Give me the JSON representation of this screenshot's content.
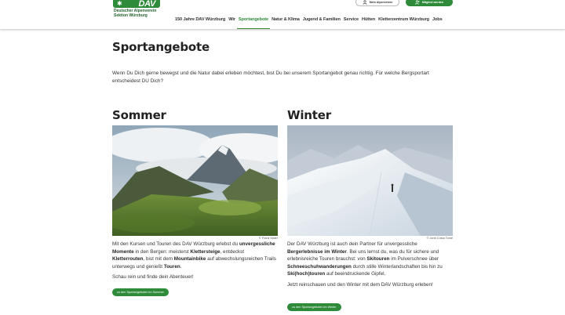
{
  "header": {
    "logo_text": "DAV",
    "org_line1": "Deutscher Alpenverein",
    "org_line2": "Sektion Würzburg",
    "account_button": "Mein Alpenverein",
    "member_button": "Mitglied werden",
    "nav": [
      {
        "label": "150 Jahre DAV Würzburg",
        "active": false
      },
      {
        "label": "Wir",
        "active": false
      },
      {
        "label": "Sportangebote",
        "active": true
      },
      {
        "label": "Natur & Klima",
        "active": false
      },
      {
        "label": "Jugend & Familien",
        "active": false
      },
      {
        "label": "Service",
        "active": false
      },
      {
        "label": "Hütten",
        "active": false
      },
      {
        "label": "Kletterzentrum Würzburg",
        "active": false
      },
      {
        "label": "Jobs",
        "active": false
      }
    ]
  },
  "main": {
    "title": "Sportangebote",
    "intro": "Wenn Du Dich gerne bewegst und die Natur dabei erleben möchtest, bist Du bei unserem Sportangebot genau richtig. Für welche Bergsportart entscheidest DU Dich?"
  },
  "sommer": {
    "title": "Sommer",
    "photo_credit": "© Franz Maier",
    "text_parts": [
      {
        "t": "Mit den Kursen und Touren des DAV Würzburg erlebst du ",
        "b": false
      },
      {
        "t": "unvergessliche Momente",
        "b": true
      },
      {
        "t": " in den Bergen: meisterst ",
        "b": false
      },
      {
        "t": "Klettersteige",
        "b": true
      },
      {
        "t": ", entdeckst ",
        "b": false
      },
      {
        "t": "Kletterrouten",
        "b": true
      },
      {
        "t": ", bist mit dem ",
        "b": false
      },
      {
        "t": "Mountainbike",
        "b": true
      },
      {
        "t": " auf abwechslungsreichen Trails unterwegs und genießt ",
        "b": false
      },
      {
        "t": "Touren",
        "b": true
      },
      {
        "t": ".",
        "b": false
      }
    ],
    "closing": "Schau rein und finde dein Abenteuer!",
    "cta": "zu den Sportangeboten im Sommer"
  },
  "winter": {
    "title": "Winter",
    "photo_credit": "© Jordi Costa Tomé",
    "text_parts": [
      {
        "t": "Der DAV Würzburg ist auch dein Partner für unvergessliche ",
        "b": false
      },
      {
        "t": "Bergerlebnisse im Winter",
        "b": true
      },
      {
        "t": ". Bei uns lernst du, was du für sichere und erlebnisreiche Touren brauchst: von ",
        "b": false
      },
      {
        "t": "Skitouren",
        "b": true
      },
      {
        "t": " im Pulverschnee über ",
        "b": false
      },
      {
        "t": "Schneeschuhwanderungen",
        "b": true
      },
      {
        "t": " durch stille Winterlandschaften bis hin zu ",
        "b": false
      },
      {
        "t": "Ski(hoch)touren",
        "b": true
      },
      {
        "t": " auf beeindruckende Gipfel.",
        "b": false
      }
    ],
    "closing": "Jetzt reinschauen und den Winter mit dem DAV Würzburg erleben!",
    "cta": "zu den Sportangeboten im Winter"
  },
  "colors": {
    "brand_green": "#2e8b3a",
    "text": "#333333"
  }
}
